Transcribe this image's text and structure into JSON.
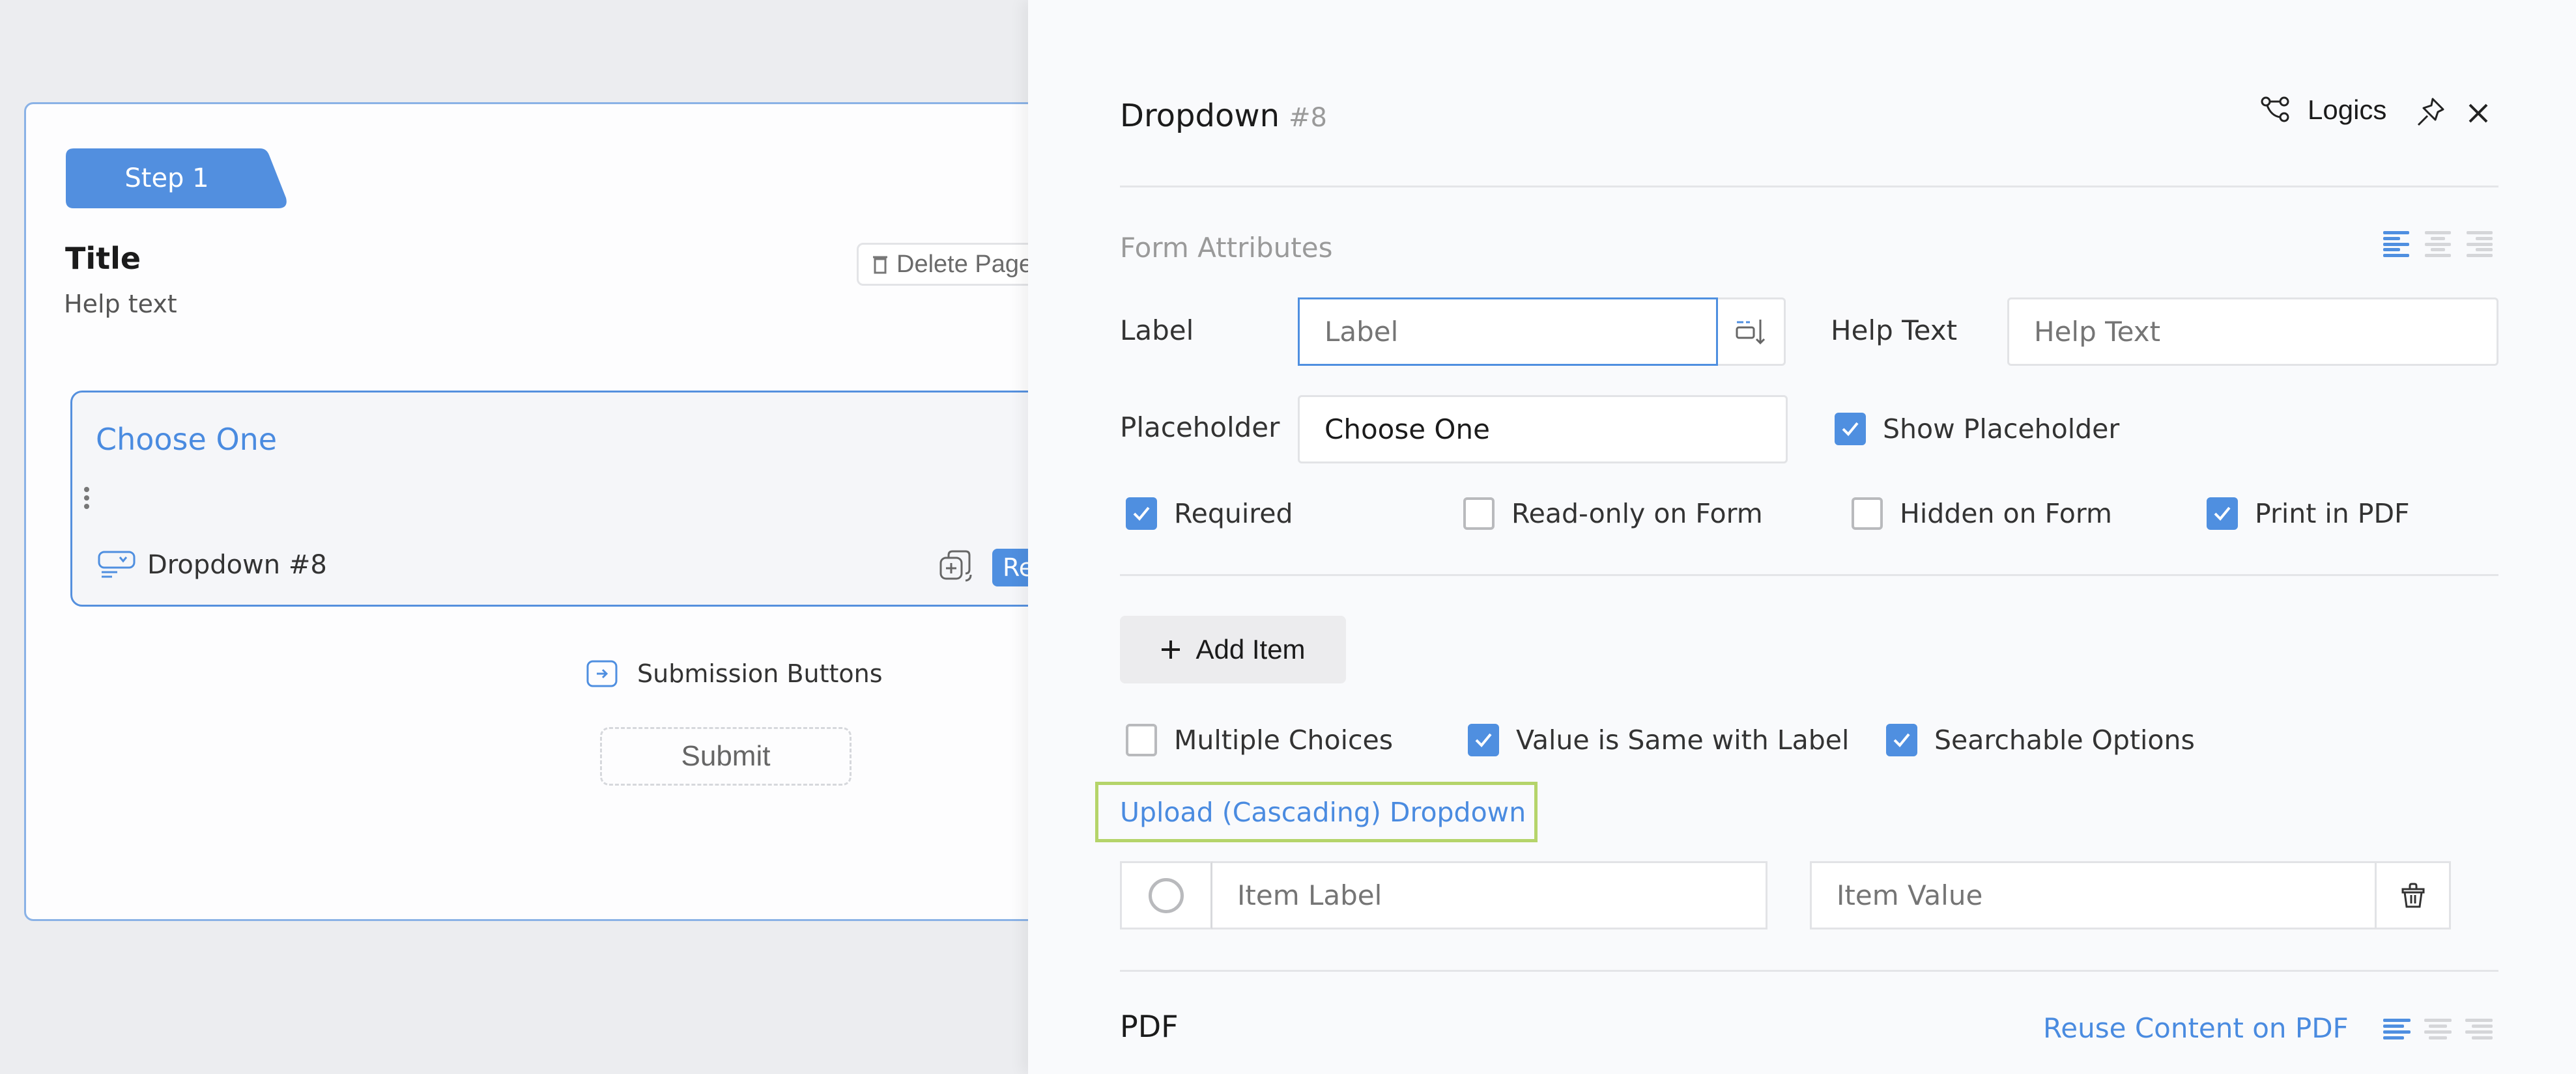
{
  "canvas": {
    "step_label": "Step 1",
    "page_title": "Title",
    "page_help_text": "Help text",
    "delete_page_label": "Delete Page",
    "field_label": "Choose One",
    "field_type_label": "Dropdown #8",
    "required_badge_label": "Re",
    "submission_buttons_label": "Submission Buttons",
    "submit_label": "Submit"
  },
  "panel": {
    "title": "Dropdown",
    "field_number": "#8",
    "logics_label": "Logics",
    "form_attributes_title": "Form Attributes",
    "label_field": {
      "label": "Label",
      "value": "",
      "placeholder": "Label"
    },
    "help_text_field": {
      "label": "Help Text",
      "value": "",
      "placeholder": "Help Text"
    },
    "placeholder_field": {
      "label": "Placeholder",
      "value": "Choose One"
    },
    "show_placeholder": {
      "label": "Show Placeholder",
      "checked": true
    },
    "attributes": [
      {
        "label": "Required",
        "checked": true
      },
      {
        "label": "Read-only on Form",
        "checked": false
      },
      {
        "label": "Hidden on Form",
        "checked": false
      },
      {
        "label": "Print in PDF",
        "checked": true
      }
    ],
    "add_item_label": "Add Item",
    "options": [
      {
        "label": "Multiple Choices",
        "checked": false
      },
      {
        "label": "Value is Same with Label",
        "checked": true
      },
      {
        "label": "Searchable Options",
        "checked": true
      }
    ],
    "upload_link_label": "Upload (Cascading) Dropdown",
    "items": [
      {
        "label": "",
        "label_placeholder": "Item Label",
        "value": "",
        "value_placeholder": "Item Value"
      }
    ],
    "pdf_title": "PDF",
    "reuse_content_label": "Reuse Content on PDF",
    "alignment_selected": "left"
  },
  "colors": {
    "accent": "#4f8fe0",
    "highlight_outline": "#b5d46a"
  }
}
